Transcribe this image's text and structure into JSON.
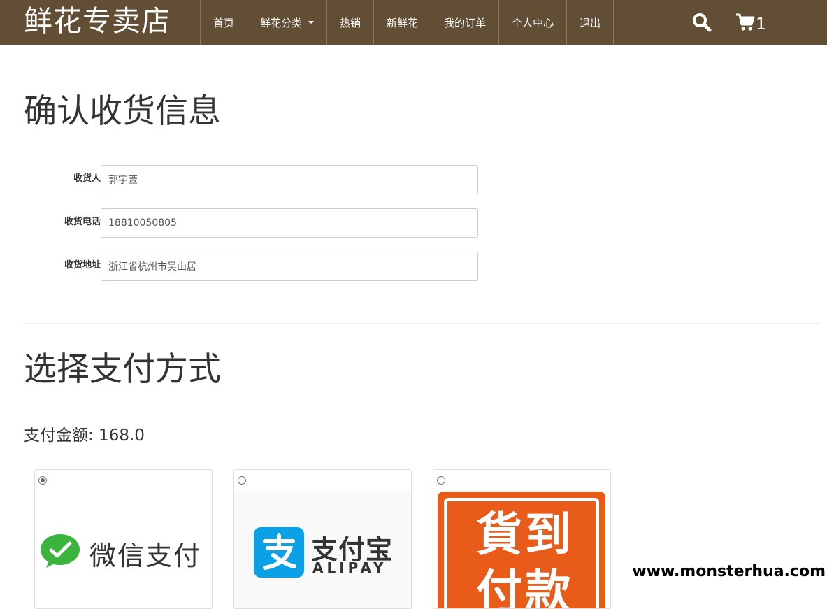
{
  "brand": "鲜花专卖店",
  "nav": {
    "items": [
      "首页",
      "鲜花分类",
      "热销",
      "新鲜花",
      "我的订单",
      "个人中心",
      "退出"
    ],
    "cart_count": "1"
  },
  "confirm": {
    "title": "确认收货信息",
    "fields": [
      {
        "label": "收货人",
        "value": "郭宇萱"
      },
      {
        "label": "收货电话",
        "value": "18810050805"
      },
      {
        "label": "收货地址",
        "value": "浙江省杭州市吴山居"
      }
    ]
  },
  "payment": {
    "title": "选择支付方式",
    "amount_text": "支付金额: 168.0",
    "options": [
      {
        "name": "微信支付",
        "selected": true
      },
      {
        "name": "支付宝",
        "sub": "ALIPAY",
        "selected": false
      },
      {
        "line1": "貨到",
        "line2": "付款",
        "selected": false
      }
    ]
  },
  "colors": {
    "navbar": "#624e34",
    "wechat_green": "#3ab43d",
    "alipay_blue": "#0ca0e6",
    "cod_orange": "#e85b19"
  },
  "watermark": "www.monsterhua.com"
}
